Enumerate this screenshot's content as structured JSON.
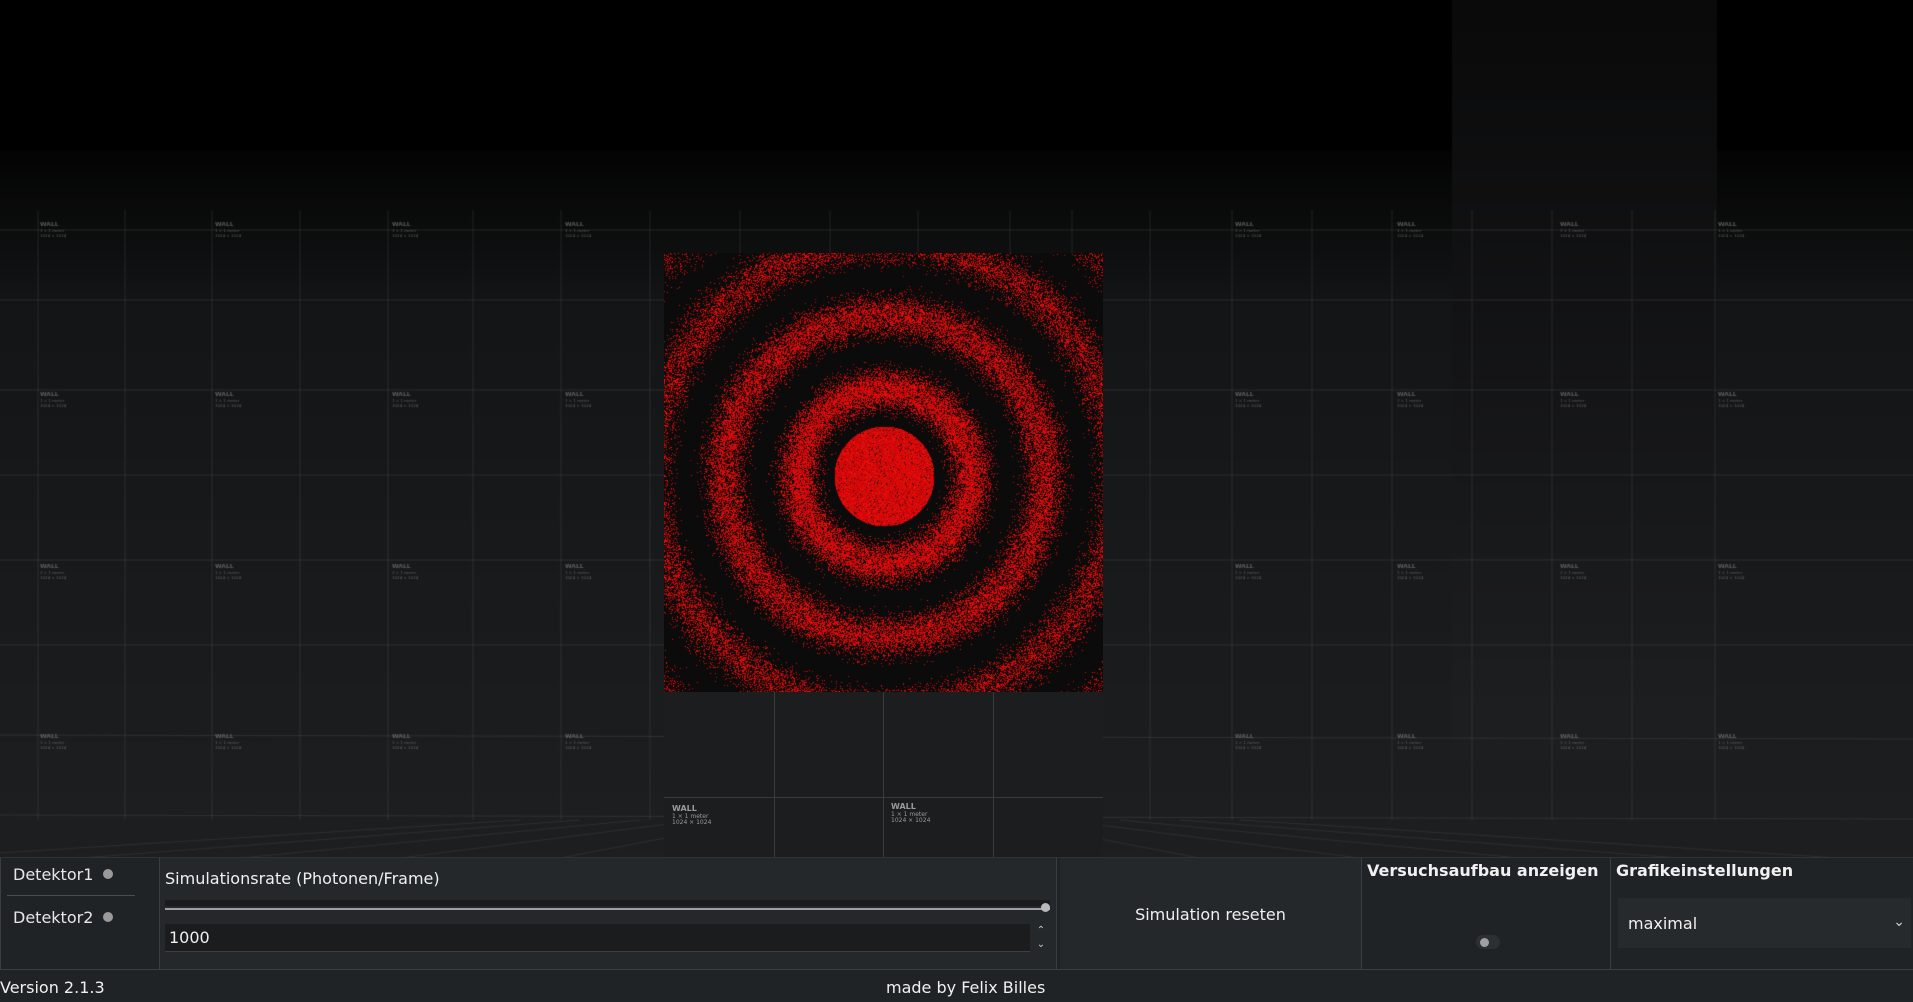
{
  "detectors": {
    "items": [
      {
        "label": "Detektor1"
      },
      {
        "label": "Detektor2"
      }
    ]
  },
  "simulation_rate": {
    "label": "Simulationsrate (Photonen/Frame)",
    "value": "1000",
    "slider_position": 1.0
  },
  "reset": {
    "label": "Simulation reseten"
  },
  "setup": {
    "label": "Versuchsaufbau anzeigen"
  },
  "graphics": {
    "label": "Grafikeinstellungen",
    "selected": "maximal"
  },
  "footer": {
    "version": "Version 2.1.3",
    "credit": "made by Felix Billes"
  },
  "wall_tag": {
    "title": "WALL",
    "line1": "1 × 1 meter",
    "line2": "1024 × 1024"
  },
  "colors": {
    "pattern": "#ff1a1a",
    "background": "#000000",
    "panel": "#202326"
  }
}
